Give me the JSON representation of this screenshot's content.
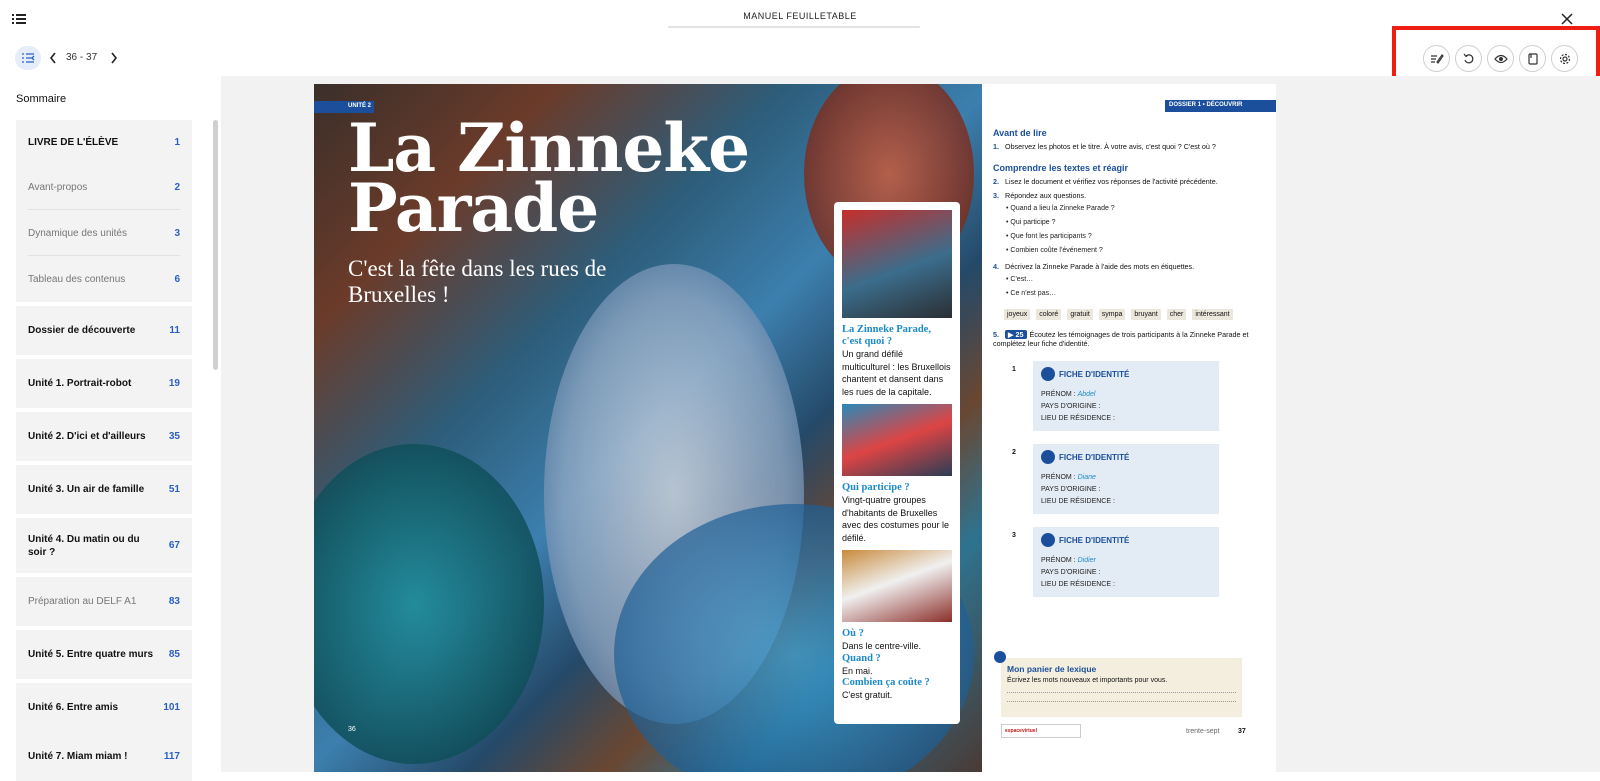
{
  "app": {
    "title": "MANUEL FEUILLETABLE"
  },
  "navigation": {
    "page_range": "36 - 37"
  },
  "sidebar": {
    "heading": "Sommaire",
    "items": [
      {
        "label": "LIVRE DE L'ÉLÈVE",
        "page": "1",
        "style": "bold"
      },
      {
        "label": "Avant-propos",
        "page": "2",
        "style": "light"
      },
      {
        "label": "Dynamique des unités",
        "page": "3",
        "style": "light"
      },
      {
        "label": "Tableau des contenus",
        "page": "6",
        "style": "light"
      },
      {
        "label": "Dossier de découverte",
        "page": "11",
        "style": "bold"
      },
      {
        "label": "Unité 1. Portrait-robot",
        "page": "19",
        "style": "bold"
      },
      {
        "label": "Unité 2. D'ici et d'ailleurs",
        "page": "35",
        "style": "bold"
      },
      {
        "label": "Unité 3. Un air de famille",
        "page": "51",
        "style": "bold"
      },
      {
        "label": "Unité 4. Du matin ou du soir ?",
        "page": "67",
        "style": "bold"
      },
      {
        "label": "Préparation au DELF A1",
        "page": "83",
        "style": "light"
      },
      {
        "label": "Unité 5. Entre quatre murs",
        "page": "85",
        "style": "bold"
      },
      {
        "label": "Unité 6. Entre amis",
        "page": "101",
        "style": "bold"
      },
      {
        "label": "Unité 7. Miam miam !",
        "page": "117",
        "style": "bold"
      }
    ]
  },
  "left_page": {
    "tag": "UNITÉ 2",
    "title_line1": "La Zinneke",
    "title_line2": "Parade",
    "subtitle": "C'est la fête dans les rues de Bruxelles !",
    "page_number": "36",
    "card": {
      "q1": "La Zinneke Parade, c'est quoi ?",
      "a1": "Un grand défilé multiculturel : les Bruxellois chantent et dansent dans les rues de la capitale.",
      "q2": "Qui participe ?",
      "a2": "Vingt-quatre groupes d'habitants de Bruxelles avec des costumes pour le défilé.",
      "q3": "Où ?",
      "a3": "Dans le centre-ville.",
      "q4": "Quand ?",
      "a4": "En mai.",
      "q5": "Combien ça coûte ?",
      "a5": "C'est gratuit."
    }
  },
  "right_page": {
    "tag": "DOSSIER 1 • DÉCOUVRIR",
    "sec1": "Avant de lire",
    "q1": "Observez les photos et le titre. À votre avis, c'est quoi ? C'est où ?",
    "sec2": "Comprendre les textes et réagir",
    "q2": "Lisez le document et vérifiez vos réponses de l'activité précédente.",
    "q3": "Répondez aux questions.",
    "q3_items": [
      "Quand a lieu la Zinneke Parade ?",
      "Qui participe ?",
      "Que font les participants ?",
      "Combien coûte l'événement ?"
    ],
    "q4": "Décrivez la Zinneke Parade à l'aide des mots en étiquettes.",
    "q4_items": [
      "C'est…",
      "Ce n'est pas…"
    ],
    "chips": [
      "joyeux",
      "coloré",
      "gratuit",
      "sympa",
      "bruyant",
      "cher",
      "intéressant"
    ],
    "q5_audio": "25",
    "q5": "Écoutez les témoignages de trois participants à la Zinneke Parade et complétez leur fiche d'identité.",
    "fiche_title": "FICHE D'IDENTITÉ",
    "fiche_labels": {
      "prenom": "PRÉNOM :",
      "pays": "PAYS D'ORIGINE :",
      "lieu": "LIEU DE RÉSIDENCE :"
    },
    "fiches": [
      {
        "num": "1",
        "name": "Abdel"
      },
      {
        "num": "2",
        "name": "Diane"
      },
      {
        "num": "3",
        "name": "Didier"
      }
    ],
    "lexique_title": "Mon panier de lexique",
    "lexique_sub": "Écrivez les mots nouveaux et importants pour vous.",
    "brand": "espacevirtuel",
    "page_word": "trente-sept",
    "page_number": "37"
  },
  "colors": {
    "accent": "#1b4f9b",
    "highlight_box": "#ef1e12"
  }
}
